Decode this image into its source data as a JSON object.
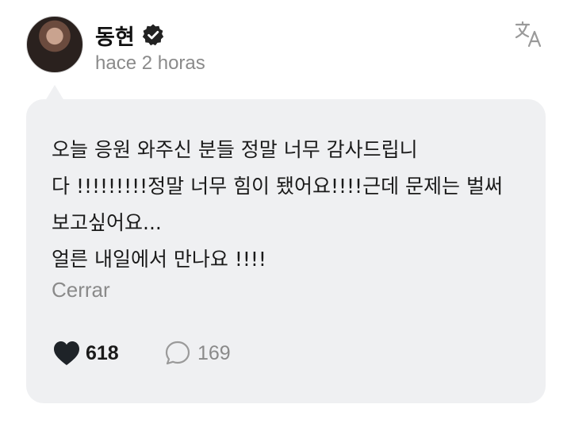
{
  "post": {
    "author": "동현",
    "verified_icon": "verified-badge-icon",
    "timestamp": "hace 2 horas",
    "translate_icon": "translate-icon",
    "message_lines": [
      "오늘 응원 와주신 분들 정말 너무 감사드립니",
      "다 !!!!!!!!!정말 너무 힘이 됐어요!!!!근데 문제는 벌써",
      "보고싶어요...",
      "얼른 내일에서 만나요 !!!!"
    ],
    "close_label": "Cerrar",
    "likes": "618",
    "comments": "169"
  },
  "colors": {
    "bubble": "#eff0f2",
    "muted_text": "#8a8a8a",
    "text": "#1a1a1a"
  }
}
